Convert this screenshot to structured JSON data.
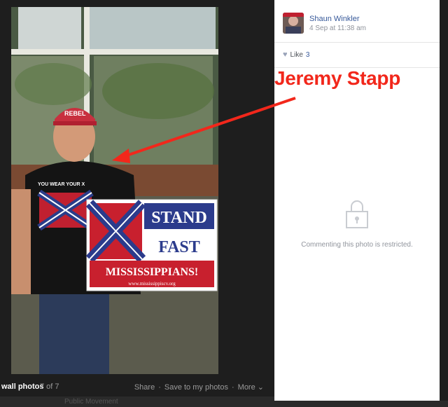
{
  "post": {
    "author": "Shaun Winkler",
    "timestamp": "4 Sep at 11:38 am",
    "like_label": "Like",
    "like_count": "3",
    "restricted_text": "Commenting this photo is restricted."
  },
  "photo": {
    "sign": {
      "line1": "STAND",
      "line2": "FAST",
      "line3": "MISSISSIPPIANS!",
      "url": "www.mississippiscv.org"
    },
    "shirt_text": "YOU WEAR YOUR X AND I'LL WEAR MINE!",
    "hat_text": "REBEL"
  },
  "bottom_bar": {
    "album": "wall photos",
    "count": "7 of 7",
    "share": "Share",
    "sep": "·",
    "save": "Save to my photos",
    "more": "More"
  },
  "footer": {
    "text": "Public Movement"
  },
  "overlay": {
    "name": "Jeremy Stapp"
  },
  "colors": {
    "arrow": "#f2271b",
    "link": "#365899",
    "meta": "#90949c"
  },
  "icons": {
    "heart": "heart-icon",
    "lock": "lock-icon",
    "chevron": "chevron-down-icon"
  }
}
